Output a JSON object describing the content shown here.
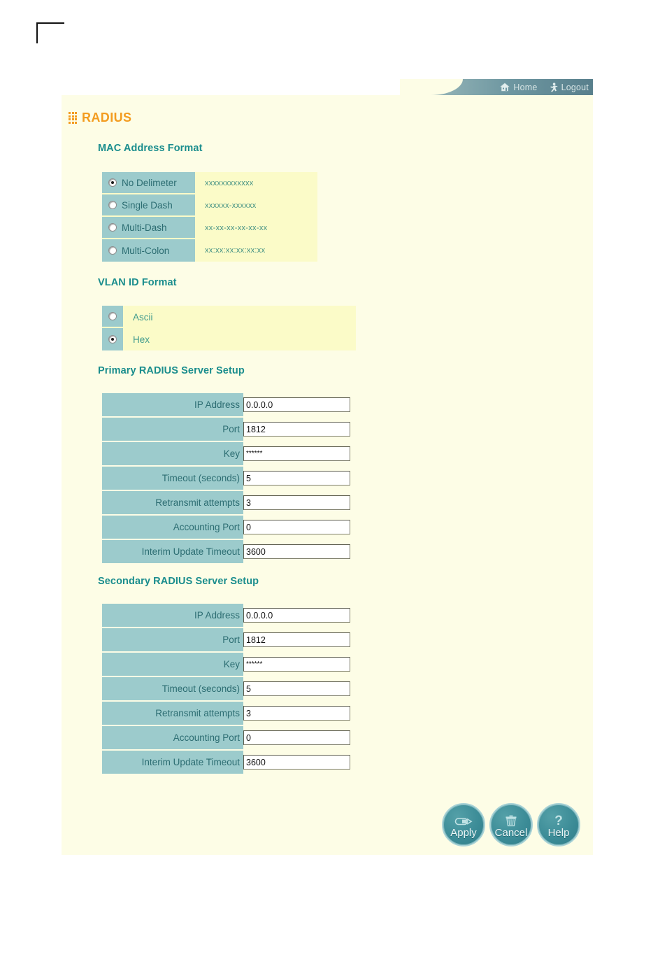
{
  "topbar": {
    "home_label": "Home",
    "logout_label": "Logout",
    "home_icon": "house-icon",
    "logout_icon": "running-person-icon"
  },
  "page": {
    "title": "RADIUS",
    "title_color": "#f39c1f",
    "heading_color": "#1a8d8d",
    "panel_bg": "#fdfde6",
    "label_cell_bg": "#9ccbcc",
    "highlight_bg": "#fbfbc8"
  },
  "mac_address_format": {
    "heading": "MAC Address Format",
    "options": [
      {
        "label": "No Delimeter",
        "example": "xxxxxxxxxxxx",
        "selected": true
      },
      {
        "label": "Single Dash",
        "example": "xxxxxx-xxxxxx",
        "selected": false
      },
      {
        "label": "Multi-Dash",
        "example": "xx-xx-xx-xx-xx-xx",
        "selected": false
      },
      {
        "label": "Multi-Colon",
        "example": "xx:xx:xx:xx:xx:xx",
        "selected": false
      }
    ]
  },
  "vlan_id_format": {
    "heading": "VLAN ID Format",
    "options": [
      {
        "label": "Ascii",
        "selected": false
      },
      {
        "label": "Hex",
        "selected": true
      }
    ]
  },
  "primary_server": {
    "heading": "Primary RADIUS Server Setup",
    "fields": [
      {
        "label": "IP Address",
        "value": "0.0.0.0",
        "masked": false
      },
      {
        "label": "Port",
        "value": "1812",
        "masked": false
      },
      {
        "label": "Key",
        "value": "******",
        "masked": true
      },
      {
        "label": "Timeout (seconds)",
        "value": "5",
        "masked": false
      },
      {
        "label": "Retransmit attempts",
        "value": "3",
        "masked": false
      },
      {
        "label": "Accounting Port",
        "value": "0",
        "masked": false
      },
      {
        "label": "Interim Update Timeout",
        "value": "3600",
        "masked": false
      }
    ]
  },
  "secondary_server": {
    "heading": "Secondary RADIUS Server Setup",
    "fields": [
      {
        "label": "IP Address",
        "value": "0.0.0.0",
        "masked": false
      },
      {
        "label": "Port",
        "value": "1812",
        "masked": false
      },
      {
        "label": "Key",
        "value": "******",
        "masked": true
      },
      {
        "label": "Timeout (seconds)",
        "value": "5",
        "masked": false
      },
      {
        "label": "Retransmit attempts",
        "value": "3",
        "masked": false
      },
      {
        "label": "Accounting Port",
        "value": "0",
        "masked": false
      },
      {
        "label": "Interim Update Timeout",
        "value": "3600",
        "masked": false
      }
    ]
  },
  "actions": [
    {
      "label": "Apply",
      "icon": "save-disk-icon"
    },
    {
      "label": "Cancel",
      "icon": "trash-can-icon"
    },
    {
      "label": "Help",
      "icon": "question-mark-icon"
    }
  ]
}
